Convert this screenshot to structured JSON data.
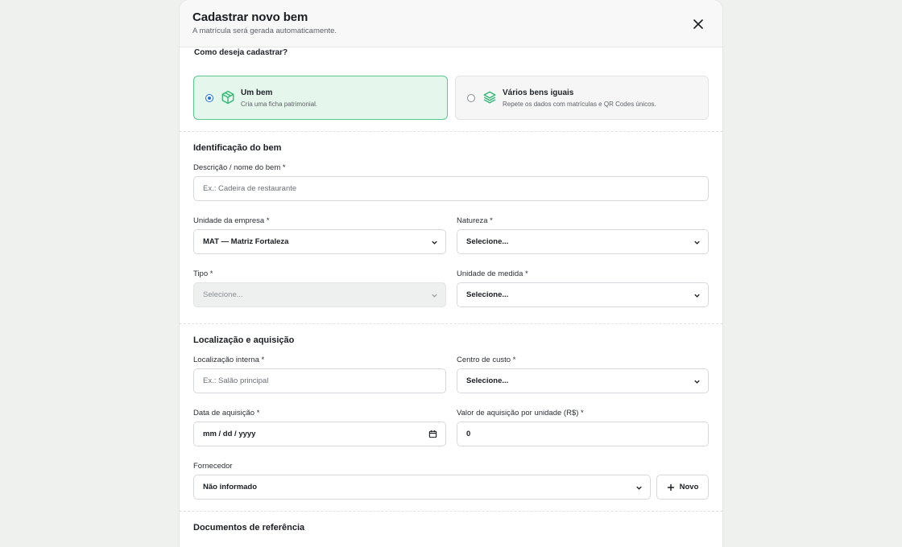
{
  "modal": {
    "title": "Cadastrar novo bem",
    "subtitle": "A matrícula será gerada automaticamente."
  },
  "mode": {
    "question": "Como deseja cadastrar?",
    "options": [
      {
        "title": "Um bem",
        "description": "Cria uma ficha patrimonial.",
        "selected": true
      },
      {
        "title": "Vários bens iguais",
        "description": "Repete os dados com matrículas e QR Codes únicos.",
        "selected": false
      }
    ]
  },
  "identificacao": {
    "heading": "Identificação do bem",
    "descricao": {
      "label": "Descrição / nome do bem *",
      "placeholder": "Ex.: Cadeira de restaurante",
      "value": ""
    },
    "unidade": {
      "label": "Unidade da empresa *",
      "value": "MAT — Matriz Fortaleza"
    },
    "natureza": {
      "label": "Natureza *",
      "value": "Selecione..."
    },
    "tipo": {
      "label": "Tipo *",
      "value": "Selecione..."
    },
    "medida": {
      "label": "Unidade de medida *",
      "value": "Selecione..."
    }
  },
  "localizacao": {
    "heading": "Localização e aquisição",
    "interna": {
      "label": "Localização interna *",
      "placeholder": "Ex.: Salão principal",
      "value": ""
    },
    "centro": {
      "label": "Centro de custo *",
      "value": "Selecione..."
    },
    "data": {
      "label": "Data de aquisição *",
      "value": "mm / dd / yyyy"
    },
    "valor": {
      "label": "Valor de aquisição por unidade (R$) *",
      "value": "0"
    },
    "fornecedor": {
      "label": "Fornecedor",
      "value": "Não informado"
    },
    "novo_label": "Novo"
  },
  "documentos": {
    "heading": "Documentos de referência"
  },
  "colors": {
    "accent": "#2fb872",
    "selected_bg": "#e5f6ec",
    "radio": "#1f6fd6"
  }
}
